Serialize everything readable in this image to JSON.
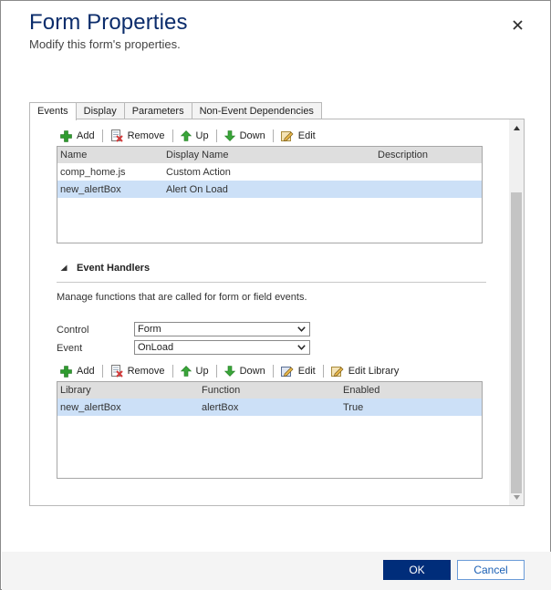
{
  "dialog": {
    "title": "Form Properties",
    "subtitle": "Modify this form's properties.",
    "ok_label": "OK",
    "cancel_label": "Cancel"
  },
  "tabs": [
    {
      "label": "Events",
      "active": true
    },
    {
      "label": "Display"
    },
    {
      "label": "Parameters"
    },
    {
      "label": "Non-Event Dependencies"
    }
  ],
  "libraries": {
    "toolbar": {
      "add": "Add",
      "remove": "Remove",
      "up": "Up",
      "down": "Down",
      "edit": "Edit"
    },
    "columns": [
      "Name",
      "Display Name",
      "Description"
    ],
    "rows": [
      {
        "name": "comp_home.js",
        "display_name": "Custom Action",
        "description": "",
        "selected": false
      },
      {
        "name": "new_alertBox",
        "display_name": "Alert On Load",
        "description": "",
        "selected": true
      }
    ]
  },
  "event_handlers": {
    "heading": "Event Handlers",
    "description": "Manage functions that are called for form or field events.",
    "control_label": "Control",
    "control_value": "Form",
    "event_label": "Event",
    "event_value": "OnLoad",
    "toolbar": {
      "add": "Add",
      "remove": "Remove",
      "up": "Up",
      "down": "Down",
      "edit": "Edit",
      "edit_library": "Edit Library"
    },
    "columns": [
      "Library",
      "Function",
      "Enabled"
    ],
    "rows": [
      {
        "library": "new_alertBox",
        "function": "alertBox",
        "enabled": "True",
        "selected": true
      }
    ]
  },
  "colors": {
    "title": "#0b2c6b",
    "primary_button": "#002d7a",
    "selected_row": "#cce0f7",
    "add_icon": "#2e9b2e",
    "arrow_icon": "#3aa53a"
  }
}
